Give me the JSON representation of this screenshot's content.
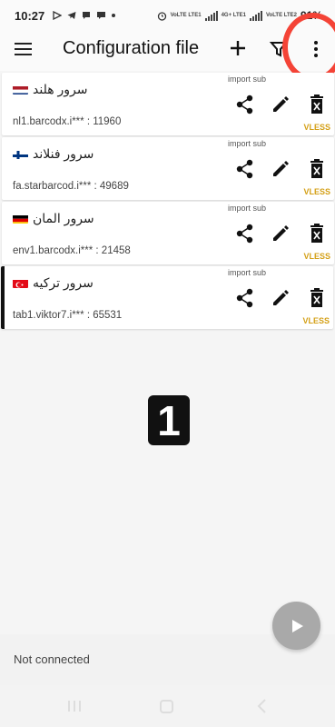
{
  "status_bar": {
    "time": "10:27",
    "battery": "91%",
    "network_labels": [
      "VoLTE LTE1",
      "4G+ LTE1",
      "VoLTE LTE2"
    ]
  },
  "app_bar": {
    "title": "Configuration file",
    "icons": [
      "menu-icon",
      "add-icon",
      "filter-icon",
      "more-vert-icon"
    ]
  },
  "servers": [
    {
      "name": "سرور هلند",
      "flag": "netherlands",
      "address": "nl1.barcodx.i*** : 11960",
      "sub": "import sub",
      "protocol": "VLESS",
      "active": false
    },
    {
      "name": "سرور فنلاند",
      "flag": "finland",
      "address": "fa.starbarcod.i*** : 49689",
      "sub": "import sub",
      "protocol": "VLESS",
      "active": false
    },
    {
      "name": "سرور المان",
      "flag": "germany",
      "address": "env1.barcodx.i*** : 21458",
      "sub": "import sub",
      "protocol": "VLESS",
      "active": false
    },
    {
      "name": "سرور ترکیه",
      "flag": "turkey",
      "address": "tab1.viktor7.i*** : 65531",
      "sub": "import sub",
      "protocol": "VLESS",
      "active": true
    }
  ],
  "step_badge": "1",
  "connection_status": "Not connected",
  "colors": {
    "highlight": "#f44336",
    "protocol": "#d4a017",
    "fab": "#a9a9a9",
    "background": "#f5f5f5"
  }
}
